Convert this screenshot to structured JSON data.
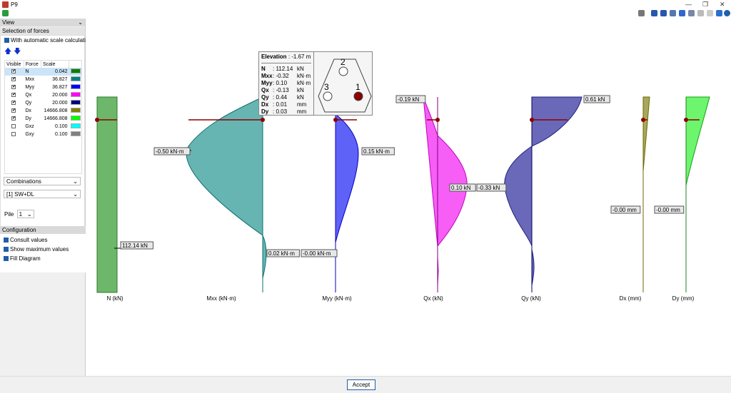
{
  "window": {
    "title": "P9"
  },
  "sidebar": {
    "view_label": "View",
    "selection_title": "Selection of forces",
    "auto_scale": {
      "label": "With automatic scale calculation",
      "checked": true
    },
    "table": {
      "headers": [
        "Visible",
        "Force",
        "Scale"
      ],
      "rows": [
        {
          "visible": true,
          "force": "N",
          "scale": "0.042",
          "color": "#008000"
        },
        {
          "visible": true,
          "force": "Mxx",
          "scale": "36.827",
          "color": "#008080"
        },
        {
          "visible": true,
          "force": "Myy",
          "scale": "36.827",
          "color": "#0000ff"
        },
        {
          "visible": true,
          "force": "Qx",
          "scale": "20.000",
          "color": "#ff00ff"
        },
        {
          "visible": true,
          "force": "Qy",
          "scale": "20.000",
          "color": "#000080"
        },
        {
          "visible": true,
          "force": "Dx",
          "scale": "14666.808",
          "color": "#808000"
        },
        {
          "visible": true,
          "force": "Dy",
          "scale": "14666.808",
          "color": "#00ff00"
        },
        {
          "visible": false,
          "force": "Gxz",
          "scale": "0.100",
          "color": "#00ffff"
        },
        {
          "visible": false,
          "force": "Gxy",
          "scale": "0.100",
          "color": "#808080"
        }
      ]
    },
    "combinations_select": "Combinations",
    "combination_value": "[1] SW+DL",
    "pile_label": "Pile",
    "pile_value": "1",
    "config_title": "Configuration",
    "config": [
      {
        "label": "Consult values",
        "checked": true
      },
      {
        "label": "Show maximum values",
        "checked": true
      },
      {
        "label": "Fill Diagram",
        "checked": true
      }
    ]
  },
  "tooltip": {
    "elevation_label": "Elevation",
    "elevation_value": ": -1.67 m",
    "rows": [
      {
        "name": "N",
        "value": ": 112.14",
        "unit": "kN"
      },
      {
        "name": "Mxx",
        "value": ": -0.32",
        "unit": "kN·m"
      },
      {
        "name": "Myy",
        "value": ": 0.10",
        "unit": "kN·m"
      },
      {
        "name": "Qx",
        "value": ": -0.13",
        "unit": "kN"
      },
      {
        "name": "Qy",
        "value": ": 0.44",
        "unit": "kN"
      },
      {
        "name": "Dx",
        "value": ": 0.01",
        "unit": "mm"
      },
      {
        "name": "Dy",
        "value": ": 0.03",
        "unit": "mm"
      }
    ],
    "piles": [
      "1",
      "2",
      "3"
    ],
    "selected_pile": "1"
  },
  "diagrams": [
    {
      "axis": "N (kN)",
      "labels": [
        "112.14 kN"
      ]
    },
    {
      "axis": "Mxx (kN·m)",
      "labels": [
        "-0.50 kN·m",
        "0.02 kN·m"
      ]
    },
    {
      "axis": "Myy (kN·m)",
      "labels": [
        "0.15 kN·m",
        "-0.00 kN·m"
      ]
    },
    {
      "axis": "Qx (kN)",
      "labels": [
        "-0.19 kN",
        "0.10 kN"
      ]
    },
    {
      "axis": "Qy (kN)",
      "labels": [
        "0.61 kN",
        "-0.33 kN"
      ]
    },
    {
      "axis": "Dx (mm)",
      "labels": [
        "-0.00 mm"
      ]
    },
    {
      "axis": "Dy (mm)",
      "labels": [
        "-0.00 mm"
      ]
    }
  ],
  "footer": {
    "accept": "Accept"
  }
}
